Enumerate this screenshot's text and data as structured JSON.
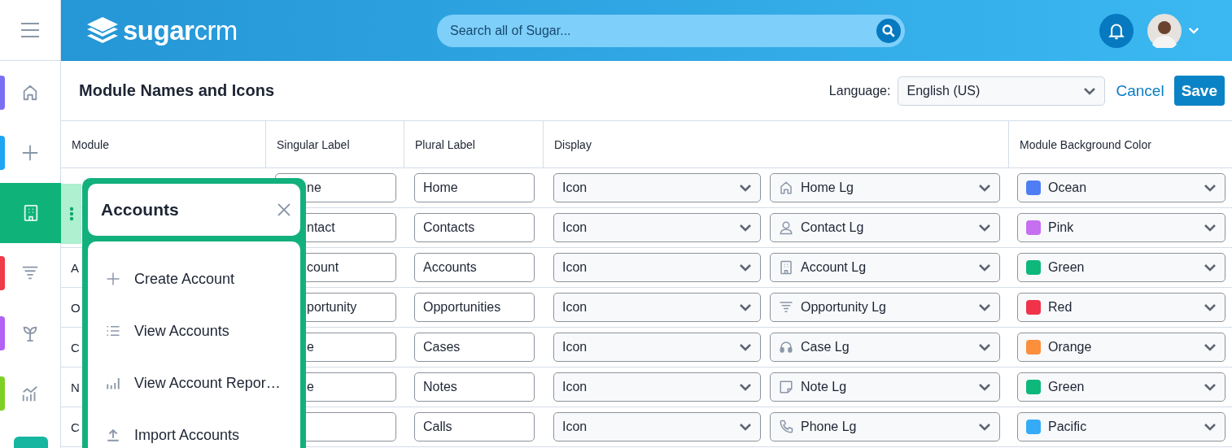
{
  "header": {
    "logo": "**sugar**crm",
    "search": {
      "placeholder": "Search all of Sugar..."
    }
  },
  "sidebar": {
    "items": [
      {
        "color": "#7b6ff2",
        "selected": false
      },
      {
        "color": "#1ea5f4",
        "selected": false
      },
      {
        "color": "#0fb37a",
        "selected": true
      },
      {
        "color": "#f03b48",
        "selected": false
      },
      {
        "color": "#b262f4",
        "selected": false
      },
      {
        "color": "#7fcf27",
        "selected": false
      }
    ]
  },
  "page": {
    "title": "Module Names and Icons",
    "language_label": "Language:",
    "language": "English (US)",
    "cancel": "Cancel",
    "save": "Save"
  },
  "table": {
    "columns": [
      "Module",
      "Singular Label",
      "Plural Label",
      "Display",
      "Module Background Color"
    ],
    "rows": [
      {
        "singular": "ne",
        "plural": "Home",
        "display": "Icon",
        "icon": "Home Lg",
        "color_name": "Ocean",
        "color": "#4f7df3"
      },
      {
        "singular": "ntact",
        "plural": "Contacts",
        "display": "Icon",
        "icon": "Contact Lg",
        "color_name": "Pink",
        "color": "#c66ff0"
      },
      {
        "module": "A",
        "singular": "count",
        "plural": "Accounts",
        "display": "Icon",
        "icon": "Account Lg",
        "color_name": "Green",
        "color": "#0eb87b"
      },
      {
        "module": "O",
        "singular": "portunity",
        "plural": "Opportunities",
        "display": "Icon",
        "icon": "Opportunity Lg",
        "color_name": "Red",
        "color": "#f1334a"
      },
      {
        "module": "C",
        "singular": "e",
        "plural": "Cases",
        "display": "Icon",
        "icon": "Case Lg",
        "color_name": "Orange",
        "color": "#fb8f3c"
      },
      {
        "module": "N",
        "singular": "e",
        "plural": "Notes",
        "display": "Icon",
        "icon": "Note Lg",
        "color_name": "Green",
        "color": "#0eb87b"
      },
      {
        "module": "C",
        "plural": "Calls",
        "display": "Icon",
        "icon": "Phone Lg",
        "color_name": "Pacific",
        "color": "#35abf8"
      }
    ]
  },
  "popup": {
    "title": "Accounts",
    "items": [
      "Create Account",
      "View Accounts",
      "View Account Repor…",
      "Import Accounts"
    ]
  }
}
